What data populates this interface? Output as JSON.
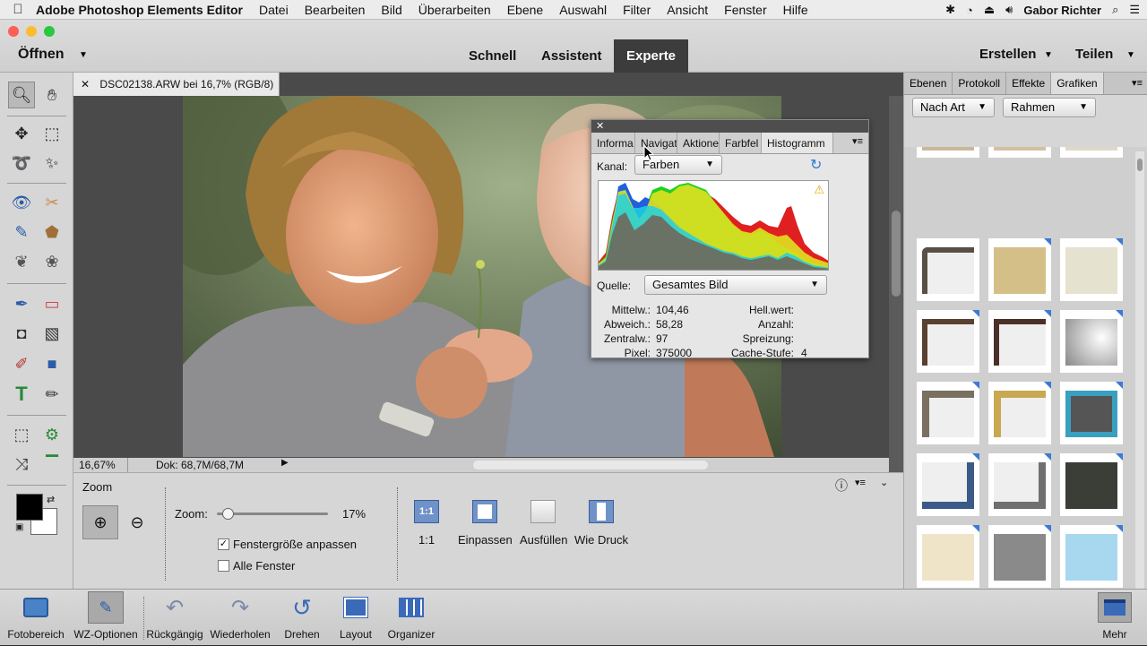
{
  "menubar": {
    "app": "Adobe Photoshop Elements Editor",
    "items": [
      "Datei",
      "Bearbeiten",
      "Bild",
      "Überarbeiten",
      "Ebene",
      "Auswahl",
      "Filter",
      "Ansicht",
      "Fenster",
      "Hilfe"
    ],
    "user": "Gabor Richter"
  },
  "topbar": {
    "open": "Öffnen",
    "modes": {
      "quick": "Schnell",
      "guided": "Assistent",
      "expert": "Experte"
    },
    "create": "Erstellen",
    "share": "Teilen"
  },
  "document": {
    "tab": "DSC02138.ARW bei 16,7% (RGB/8)",
    "zoom_status": "16,67%",
    "doc_status": "Dok: 68,7M/68,7M"
  },
  "histogram": {
    "tabs": [
      "Informa",
      "Navigat",
      "Aktione",
      "Farbfel",
      "Histogramm"
    ],
    "channel_label": "Kanal:",
    "channel_value": "Farben",
    "source_label": "Quelle:",
    "source_value": "Gesamtes Bild",
    "stats_left": [
      {
        "label": "Mittelw.:",
        "value": "104,46"
      },
      {
        "label": "Abweich.:",
        "value": "58,28"
      },
      {
        "label": "Zentralw.:",
        "value": "97"
      },
      {
        "label": "Pixel:",
        "value": "375000"
      }
    ],
    "stats_right": [
      {
        "label": "Hell.wert:",
        "value": ""
      },
      {
        "label": "Anzahl:",
        "value": ""
      },
      {
        "label": "Spreizung:",
        "value": ""
      },
      {
        "label": "Cache-Stufe:",
        "value": "4"
      }
    ]
  },
  "rightpanel": {
    "tabs": [
      "Ebenen",
      "Protokoll",
      "Effekte",
      "Grafiken"
    ],
    "filter1": "Nach Art",
    "filter2": "Rahmen"
  },
  "options": {
    "title": "Zoom",
    "zoom_label": "Zoom:",
    "zoom_value": "17%",
    "zoom_fraction": 0.05,
    "fit_window": "Fenstergröße anpassen",
    "all_windows": "Alle Fenster",
    "btn_1to1_icon": "1:1",
    "btn_1to1": "1:1",
    "btn_fit": "Einpassen",
    "btn_fill": "Ausfüllen",
    "btn_print": "Wie Druck"
  },
  "taskbar": {
    "photo_bin": "Fotobereich",
    "tool_options": "WZ-Optionen",
    "undo": "Rückgängig",
    "redo": "Wiederholen",
    "rotate": "Drehen",
    "layout": "Layout",
    "organizer": "Organizer",
    "more": "Mehr"
  }
}
